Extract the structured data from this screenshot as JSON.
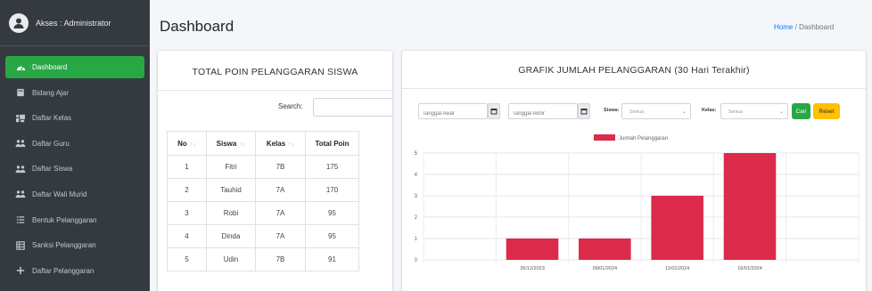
{
  "sidebar": {
    "user_label": "Akses : Administrator",
    "items": [
      {
        "label": "Dashboard",
        "icon": "dashboard-icon",
        "active": true
      },
      {
        "label": "Bidang Ajar",
        "icon": "book-icon",
        "active": false
      },
      {
        "label": "Daftar Kelas",
        "icon": "classroom-icon",
        "active": false
      },
      {
        "label": "Daftar Guru",
        "icon": "users-icon",
        "active": false
      },
      {
        "label": "Daftar Siswa",
        "icon": "users-icon",
        "active": false
      },
      {
        "label": "Daftar Wali Murid",
        "icon": "users-icon",
        "active": false
      },
      {
        "label": "Bentuk Pelanggaran",
        "icon": "list-icon",
        "active": false
      },
      {
        "label": "Sanksi Pelanggaran",
        "icon": "table-icon",
        "active": false
      },
      {
        "label": "Daftar Pelanggaran",
        "icon": "plus-icon",
        "active": false
      }
    ]
  },
  "header": {
    "title": "Dashboard",
    "breadcrumb_home": "Home",
    "breadcrumb_sep": "/",
    "breadcrumb_current": "Dashboard"
  },
  "left_card": {
    "title": "TOTAL POIN PELANGGARAN SISWA",
    "search_label": "Search:",
    "search_value": "",
    "columns": [
      "No",
      "Siswa",
      "Kelas",
      "Total Poin"
    ],
    "rows": [
      [
        "1",
        "Fitri",
        "7B",
        "175"
      ],
      [
        "2",
        "Tauhid",
        "7A",
        "170"
      ],
      [
        "3",
        "Robi",
        "7A",
        "95"
      ],
      [
        "4",
        "Dinda",
        "7A",
        "95"
      ],
      [
        "5",
        "Udin",
        "7B",
        "91"
      ]
    ]
  },
  "right_card": {
    "title": "GRAFIK JUMLAH PELANGGARAN (30 Hari Terakhir)",
    "filter": {
      "start_placeholder": "Tanggal Awal",
      "end_placeholder": "Tanggal Akhir",
      "siswa_label": "Siswa:",
      "siswa_value": "Semua",
      "kelas_label": "Kelas:",
      "kelas_value": "Semua",
      "cari_label": "Cari",
      "reset_label": "Reset"
    }
  },
  "colors": {
    "sidebar_bg": "#343a40",
    "active_green": "#28a745",
    "bar_red": "#dc2a4a",
    "reset_yellow": "#ffc107",
    "link_blue": "#007bff"
  },
  "chart_data": {
    "type": "bar",
    "categories": [
      "26/12/2023",
      "09/01/2024",
      "11/01/2024",
      "16/01/2024"
    ],
    "series": [
      {
        "name": "Jumlah Pelanggaran",
        "values": [
          1,
          1,
          3,
          5
        ]
      }
    ],
    "ylim": [
      0,
      5
    ],
    "yticks": [
      "0",
      "1",
      "2",
      "3",
      "4",
      "5"
    ],
    "legend": "top-center",
    "grid": true,
    "title": "",
    "xlabel": "",
    "ylabel": ""
  }
}
